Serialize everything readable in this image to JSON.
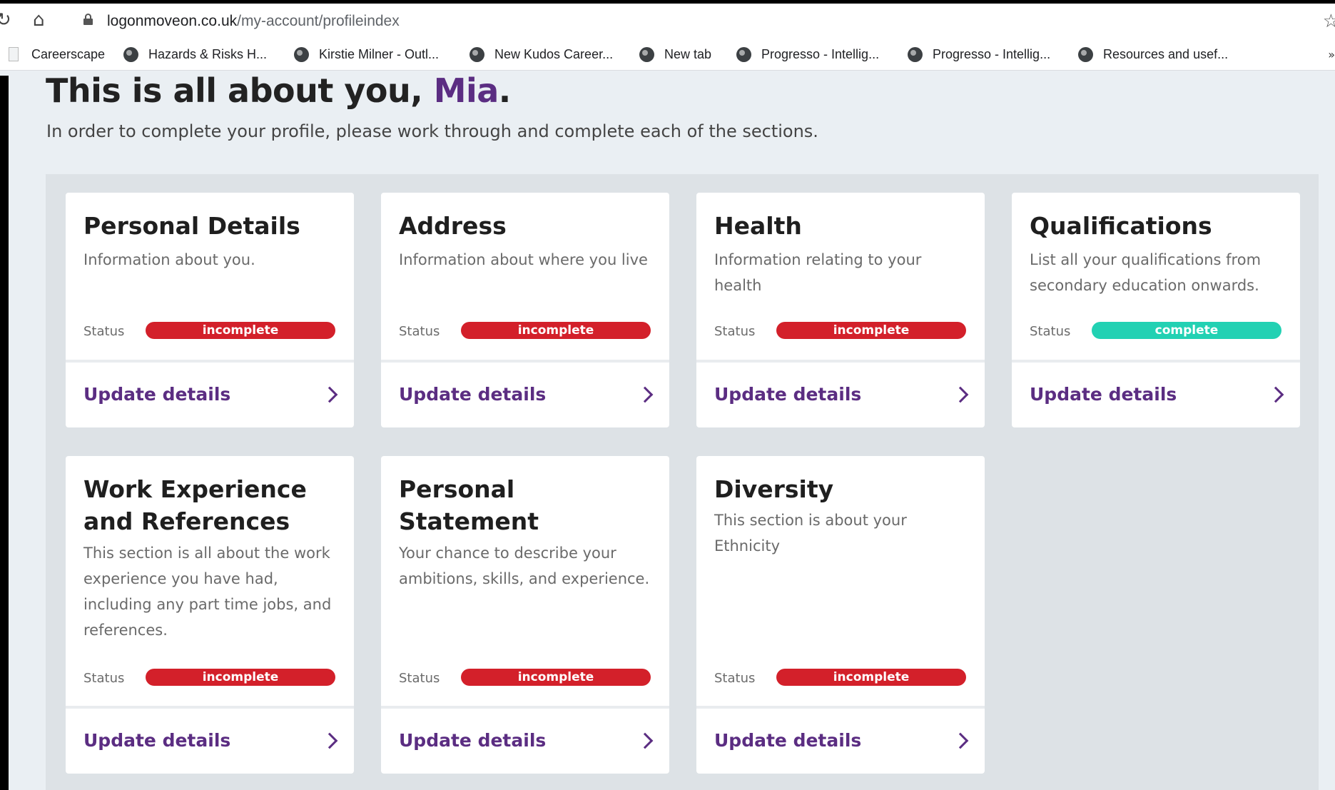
{
  "browser": {
    "url_domain": "logonmoveon.co.uk",
    "url_path": "/my-account/profileindex",
    "bookmarks": [
      "Careerscape",
      "Hazards & Risks  H...",
      "Kirstie Milner - Outl...",
      "New Kudos Career...",
      "New tab",
      "Progresso - Intellig...",
      "Progresso - Intellig...",
      "Resources and usef..."
    ],
    "more_label": "»"
  },
  "header": {
    "title_prefix": "This is all about you, ",
    "user_name": "Mia",
    "title_suffix": ".",
    "subtitle": "In order to complete your profile, please work through and complete each of the sections."
  },
  "cards": [
    {
      "title": "Personal Details",
      "description": "Information about you.",
      "status_label": "Status",
      "status": "incomplete",
      "action": "Update details"
    },
    {
      "title": "Address",
      "description": "Information about where you live",
      "status_label": "Status",
      "status": "incomplete",
      "action": "Update details"
    },
    {
      "title": "Health",
      "description": "Information relating to your health",
      "status_label": "Status",
      "status": "incomplete",
      "action": "Update details"
    },
    {
      "title": "Qualifications",
      "description": "List all your qualifications from secondary education onwards.",
      "status_label": "Status",
      "status": "complete",
      "action": "Update details"
    },
    {
      "title": "Work Experience and References",
      "description": "This section is all about the work experience you have had, including any part time jobs, and references.",
      "status_label": "Status",
      "status": "incomplete",
      "action": "Update details"
    },
    {
      "title": "Personal Statement",
      "description": "Your chance to describe your ambitions, skills, and experience.",
      "status_label": "Status",
      "status": "incomplete",
      "action": "Update details"
    },
    {
      "title": "Diversity",
      "description": "This section is about your Ethnicity",
      "status_label": "Status",
      "status": "incomplete",
      "action": "Update details"
    }
  ],
  "colors": {
    "brand_purple": "#5b2d82",
    "incomplete_red": "#d3202a",
    "complete_teal": "#22d1b3",
    "panel_grey": "#dde2e6"
  }
}
